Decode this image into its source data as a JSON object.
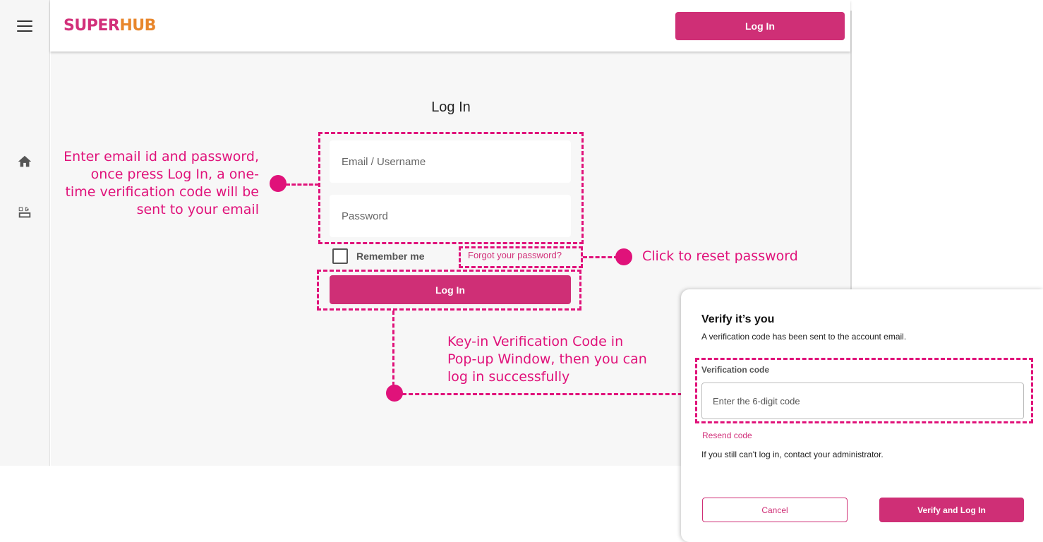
{
  "header": {
    "logo_part1": "SUPER",
    "logo_part2": "HUB",
    "login_label": "Log In"
  },
  "sidebar": {
    "items": [
      {
        "icon": "home-icon"
      },
      {
        "icon": "gift-box-icon"
      }
    ]
  },
  "login_form": {
    "title": "Log In",
    "email_placeholder": "Email / Username",
    "password_placeholder": "Password",
    "remember_label": "Remember me",
    "forgot_label": "Forgot your password?",
    "submit_label": "Log In"
  },
  "annotations": {
    "credentials_note_lines": [
      "Enter email id and password,",
      "once press Log In, a one-",
      "time verification code will be",
      "sent to your email"
    ],
    "reset_note": "Click to reset password",
    "verify_note_lines": [
      "Key-in Verification Code in",
      "Pop-up Window, then you can",
      "log in successfully"
    ],
    "color": "#e0127a"
  },
  "verify_modal": {
    "title": "Verify it’s you",
    "subtitle": "A verification code has been sent to the account email.",
    "code_label": "Verification code",
    "code_placeholder": "Enter the 6-digit code",
    "resend_label": "Resend code",
    "help_text": "If you still can't log in, contact your administrator.",
    "cancel_label": "Cancel",
    "verify_label": "Verify and Log In"
  },
  "colors": {
    "brand_primary": "#cf2f76",
    "brand_secondary": "#e8862b"
  }
}
